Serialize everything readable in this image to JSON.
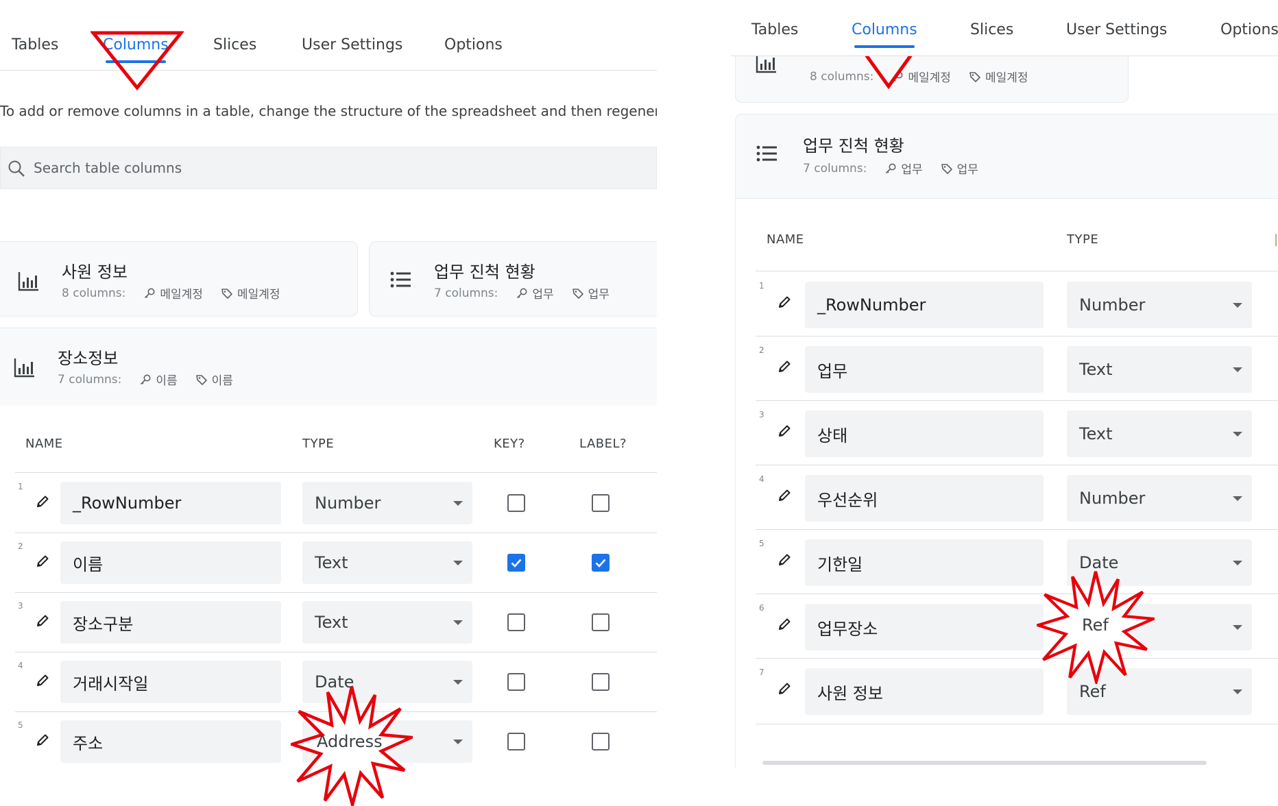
{
  "left": {
    "tabs": [
      "Tables",
      "Columns",
      "Slices",
      "User Settings",
      "Options"
    ],
    "info_text": "To add or remove columns in a table, change the structure of the spreadsheet and then regenerate th",
    "search_placeholder": "Search table columns",
    "cards": [
      {
        "name": "사원 정보",
        "count": "8 columns:",
        "key": "메일계정",
        "label": "메일계정",
        "icon": "chart-icon"
      },
      {
        "name": "업무 진척 현황",
        "count": "7 columns:",
        "key": "업무",
        "label": "업무",
        "icon": "list-icon"
      },
      {
        "name": "장소정보",
        "count": "7 columns:",
        "key": "이름",
        "label": "이름",
        "icon": "chart-icon"
      }
    ],
    "headers": {
      "name": "NAME",
      "type": "TYPE",
      "key": "KEY?",
      "label": "LABEL?"
    },
    "rows": [
      {
        "num": "1",
        "name": "_RowNumber",
        "type": "Number",
        "key": false,
        "label": false
      },
      {
        "num": "2",
        "name": "이름",
        "type": "Text",
        "key": true,
        "label": true
      },
      {
        "num": "3",
        "name": "장소구분",
        "type": "Text",
        "key": false,
        "label": false
      },
      {
        "num": "4",
        "name": "거래시작일",
        "type": "Date",
        "key": false,
        "label": false
      },
      {
        "num": "5",
        "name": "주소",
        "type": "Address",
        "key": false,
        "label": false
      }
    ]
  },
  "right": {
    "tabs": [
      "Tables",
      "Columns",
      "Slices",
      "User Settings",
      "Options"
    ],
    "top_card": {
      "count": "8 columns:",
      "key": "메일계정",
      "label": "메일계정"
    },
    "card": {
      "name": "업무 진척 현황",
      "count": "7 columns:",
      "key": "업무",
      "label": "업무"
    },
    "headers": {
      "name": "NAME",
      "type": "TYPE"
    },
    "rows": [
      {
        "num": "1",
        "name": "_RowNumber",
        "type": "Number"
      },
      {
        "num": "2",
        "name": "업무",
        "type": "Text"
      },
      {
        "num": "3",
        "name": "상태",
        "type": "Text"
      },
      {
        "num": "4",
        "name": "우선순위",
        "type": "Number"
      },
      {
        "num": "5",
        "name": "기한일",
        "type": "Date"
      },
      {
        "num": "6",
        "name": "업무장소",
        "type": "Ref"
      },
      {
        "num": "7",
        "name": "사원 정보",
        "type": "Ref"
      }
    ]
  },
  "colors": {
    "accent": "#1a73e8",
    "annotation": "#e8000b"
  }
}
